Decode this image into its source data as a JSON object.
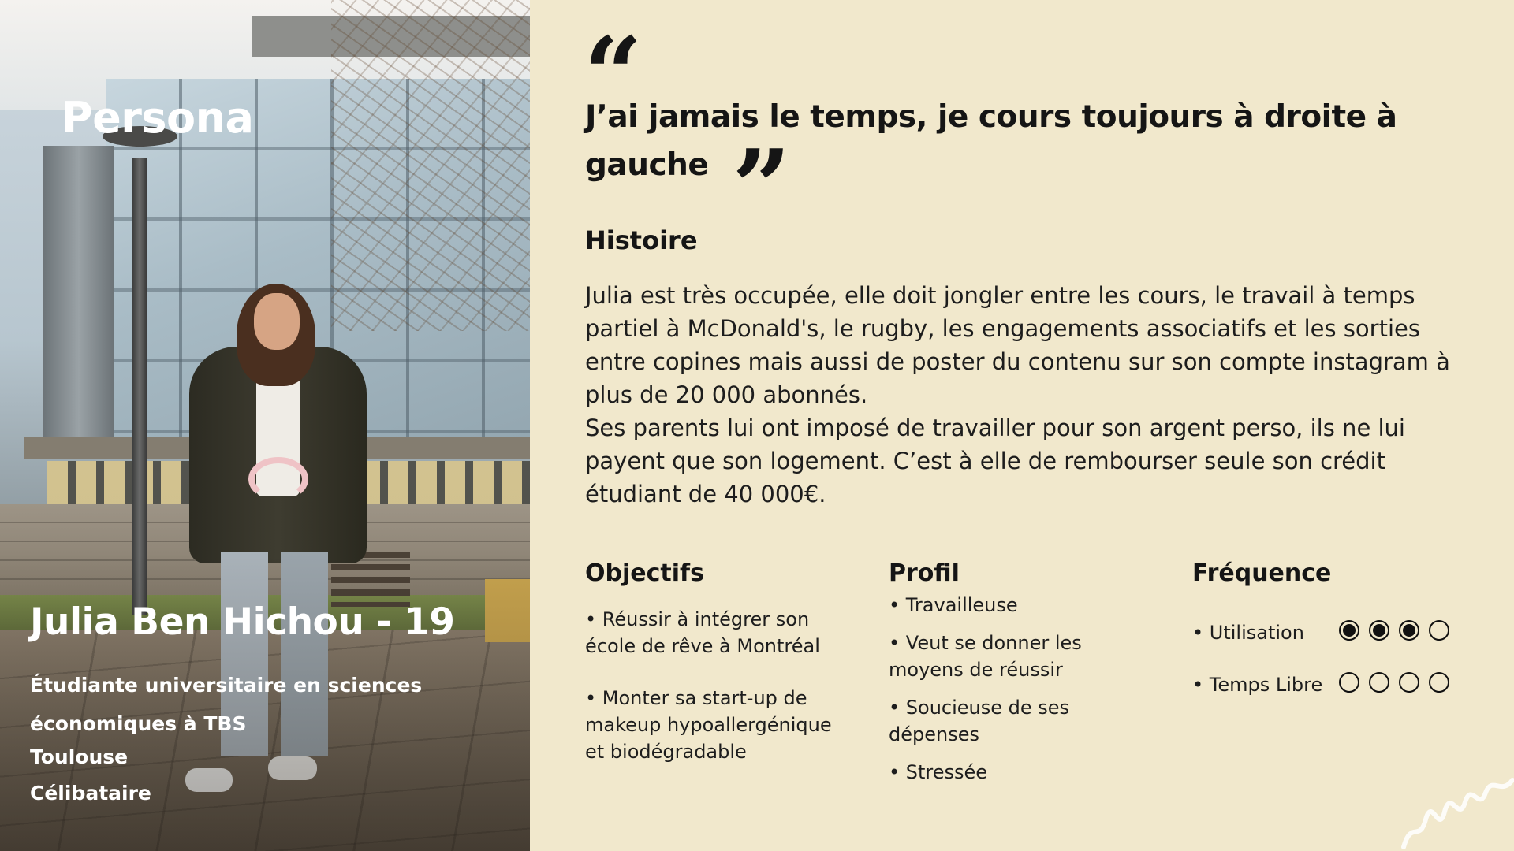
{
  "persona": {
    "title": "Persona",
    "name": "Julia Ben Hichou - 19",
    "subtitle": "Étudiante universitaire en sciences économiques à TBS",
    "city": "Toulouse",
    "status": "Célibataire"
  },
  "quote": {
    "open_mark": "“",
    "text": "J’ai jamais le temps, je cours toujours à droite à gauche",
    "close_mark": "”"
  },
  "history": {
    "heading": "Histoire",
    "paragraph1": "Julia est très occupée, elle doit jongler entre les cours, le travail à temps partiel à McDonald's, le rugby, les engagements associatifs et les sorties entre copines mais aussi de poster du contenu sur son compte instagram à plus de 20 000 abonnés.",
    "paragraph2": "Ses parents lui ont imposé de travailler pour son argent perso, ils ne lui payent que son logement. C’est à elle de rembourser seule son crédit étudiant de 40 000€."
  },
  "objectives": {
    "heading": "Objectifs",
    "items": [
      "• Réussir à intégrer son école de rêve à Montréal",
      "• Monter sa start-up de makeup hypoallergénique et biodégradable"
    ]
  },
  "profile": {
    "heading": "Profil",
    "items": [
      "• Travailleuse",
      "• Veut se donner les moyens de réussir",
      "• Soucieuse de ses dépenses",
      "• Stressée"
    ]
  },
  "frequency": {
    "heading": "Fréquence",
    "rows": [
      {
        "label": "• Utilisation",
        "level": 3,
        "max": 4
      },
      {
        "label": "• Temps Libre",
        "level": 0,
        "max": 4
      }
    ]
  },
  "colors": {
    "background": "#f1e8cc",
    "text": "#151515",
    "overlay_text": "#ffffff"
  }
}
